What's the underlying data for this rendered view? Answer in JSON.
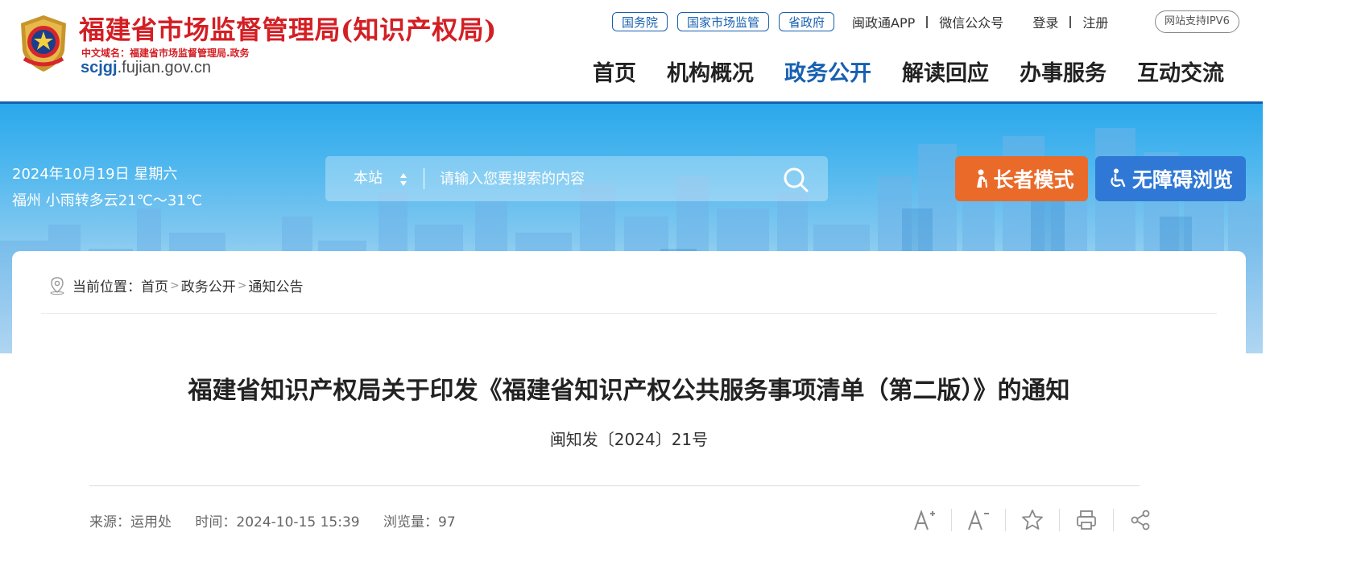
{
  "header": {
    "site_name": "福建省市场监督管理局(知识产权局)",
    "domain_cn": "中文域名：福建省市场监督管理局.政务",
    "domain_en_bold": "scjgj",
    "domain_en_rest": ".fujian.gov.cn",
    "top_links": {
      "guowuyuan": "国务院",
      "guojia": "国家市场监管",
      "shengzhengfu": "省政府",
      "app": "闽政通APP",
      "wechat": "微信公众号",
      "login": "登录",
      "register": "注册"
    },
    "ipv6": "网站支持IPV6",
    "nav": [
      "首页",
      "机构概况",
      "政务公开",
      "解读回应",
      "办事服务",
      "互动交流"
    ],
    "active_nav": "政务公开"
  },
  "banner": {
    "date": "2024年10月19日 星期六",
    "weather": "福州 小雨转多云21℃～31℃",
    "search": {
      "scope": "本站",
      "placeholder": "请输入您要搜索的内容"
    },
    "elder_mode": "长者模式",
    "accessible": "无障碍浏览"
  },
  "breadcrumb": {
    "prefix": "当前位置：",
    "items": [
      "首页",
      "政务公开",
      "通知公告"
    ]
  },
  "article": {
    "title": "福建省知识产权局关于印发《福建省知识产权公共服务事项清单（第二版）》的通知",
    "doc_number": "闽知发〔2024〕21号",
    "source": "来源：运用处",
    "time": "时间：2024-10-15 15:39",
    "views": "浏览量：97"
  },
  "colors": {
    "brand_red": "#d31f24",
    "brand_blue": "#1760b0",
    "elder_orange": "#ea6a2a",
    "access_blue": "#2f78d6"
  },
  "icons": [
    "national-emblem-icon",
    "sort-arrows-icon",
    "search-icon",
    "elder-icon",
    "wheelchair-icon",
    "location-pin-icon",
    "font-increase-icon",
    "font-decrease-icon",
    "star-icon",
    "print-icon",
    "share-icon"
  ]
}
